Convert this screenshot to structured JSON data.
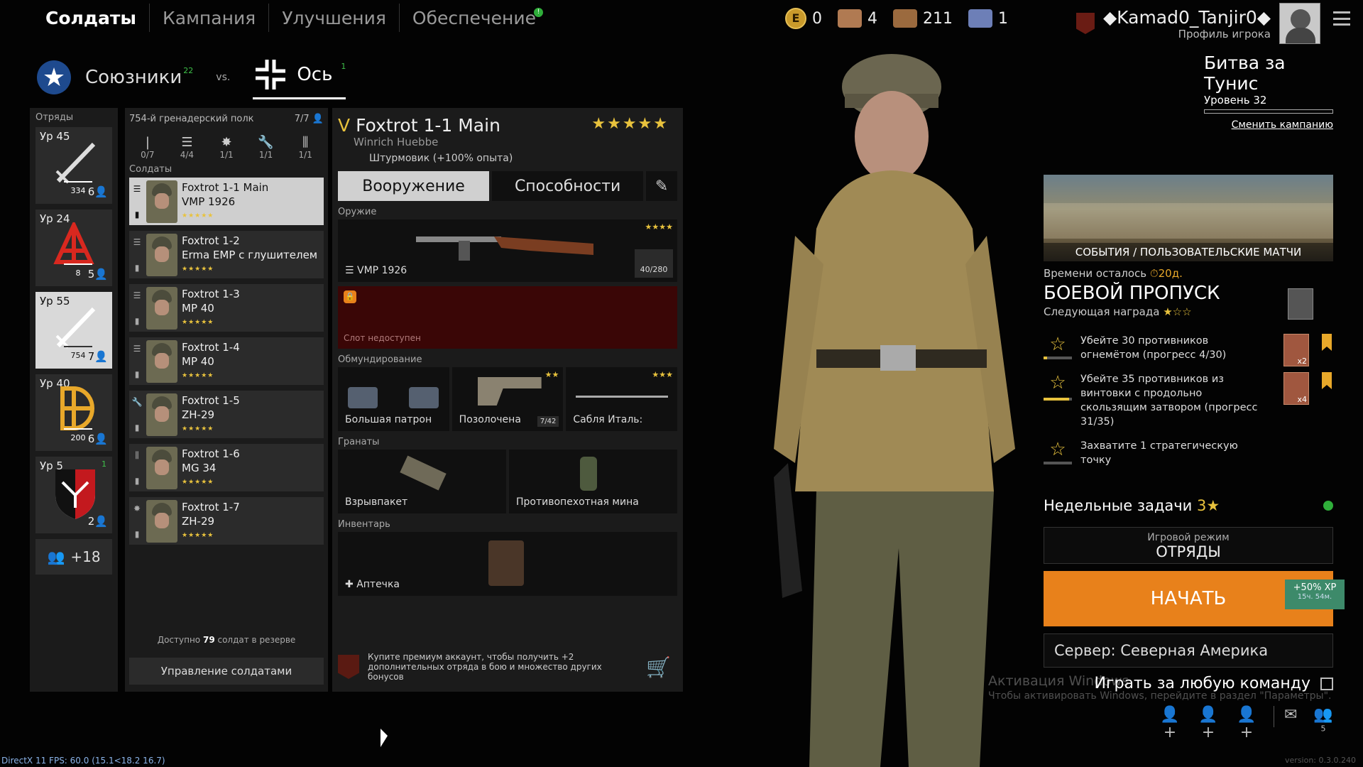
{
  "nav": {
    "tabs": [
      "Солдаты",
      "Кампания",
      "Улучшения",
      "Обеспечение"
    ],
    "supply_badge": "!"
  },
  "currencies": [
    {
      "icon": "gold-coin-icon",
      "value": "0"
    },
    {
      "icon": "weapon-order-icon",
      "value": "4"
    },
    {
      "icon": "soldier-order-icon",
      "value": "211"
    },
    {
      "icon": "silver-order-icon",
      "value": "1"
    }
  ],
  "player": {
    "name": "◆Kamad0_Tanjir0◆",
    "profile_label": "Профиль игрока"
  },
  "factions": {
    "allies": {
      "name": "Союзники",
      "count": "22"
    },
    "vs": "vs.",
    "axis": {
      "name": "Ось",
      "count": "1"
    }
  },
  "squads": {
    "header": "Отряды",
    "items": [
      {
        "level": "Ур 45",
        "xp": "334",
        "count": "6",
        "icon": "sword-icon"
      },
      {
        "level": "Ур 24",
        "xp": "8",
        "count": "5",
        "icon": "tank-emblem-icon"
      },
      {
        "level": "Ур 55",
        "xp": "754",
        "count": "7",
        "icon": "sword-icon"
      },
      {
        "level": "Ур 40",
        "xp": "200",
        "count": "6",
        "icon": "flame-emblem-icon"
      },
      {
        "level": "Ур 5",
        "xp": "",
        "count": "2",
        "icon": "shield-emblem-icon",
        "badge": "1"
      }
    ],
    "more": "+18"
  },
  "soldiers_panel": {
    "regiment": "754-й гренадерский полк",
    "capacity": "7/7",
    "roles": [
      "0/7",
      "4/4",
      "1/1",
      "1/1",
      "1/1"
    ],
    "header": "Солдаты",
    "list": [
      {
        "name": "Foxtrot 1-1 Main",
        "weapon": "VMP 1926"
      },
      {
        "name": "Foxtrot 1-2",
        "weapon": "Erma EMP с глушителем"
      },
      {
        "name": "Foxtrot 1-3",
        "weapon": "MP 40"
      },
      {
        "name": "Foxtrot 1-4",
        "weapon": "MP 40"
      },
      {
        "name": "Foxtrot 1-5",
        "weapon": "ZH-29"
      },
      {
        "name": "Foxtrot 1-6",
        "weapon": "MG 34"
      },
      {
        "name": "Foxtrot 1-7",
        "weapon": "ZH-29"
      }
    ],
    "reserve_prefix": "Доступно ",
    "reserve_count": "79",
    "reserve_suffix": " солдат в резерве",
    "manage": "Управление солдатами"
  },
  "detail": {
    "rank": "V",
    "name": "Foxtrot 1-1 Main",
    "stars": "★★★★★",
    "fullname": "Winrich Huebbe",
    "class": "Штурмовик",
    "class_bonus": "(+100% опыта)",
    "tabs": [
      "Вооружение",
      "Способности"
    ],
    "weapons_label": "Оружие",
    "weapon_name": "VMP 1926",
    "weapon_stars": "★★★★",
    "ammo": "40/280",
    "slot_unavailable": "Слот недоступен",
    "gear_label": "Обмундирование",
    "gear": [
      {
        "name": "Большая патрон",
        "stars": ""
      },
      {
        "name": "Позолочена",
        "stars": "★★",
        "ammo": "7/42"
      },
      {
        "name": "Сабля Италь:",
        "stars": "★★★"
      }
    ],
    "grenades_label": "Гранаты",
    "grenades": [
      "Взрывпакет",
      "Противопехотная мина"
    ],
    "inventory_label": "Инвентарь",
    "inventory": "Аптечка",
    "premium_text": "Купите премиум аккаунт, чтобы получить +2 дополнительных отряда в бою и множество других бонусов"
  },
  "campaign": {
    "title": "Битва за Тунис",
    "level": "Уровень 32",
    "change": "Сменить кампанию"
  },
  "events_label": "СОБЫТИЯ / ПОЛЬЗОВАТЕЛЬСКИЕ МАТЧИ",
  "battlepass": {
    "time_label": "Времени осталось",
    "time_value": "20д.",
    "title": "БОЕВОЙ ПРОПУСК",
    "next_reward": "Следующая награда",
    "tasks": [
      {
        "text": "Убейте 30 противников огнемётом (прогресс 4/30)",
        "reward_mult": "x2",
        "progress": 0.13
      },
      {
        "text": "Убейте 35 противников из винтовки с продольно скользящим затвором (прогресс 31/35)",
        "reward_mult": "x4",
        "progress": 0.89
      },
      {
        "text": "Захватите 1 стратегическую точку",
        "reward_mult": "",
        "progress": 0
      }
    ]
  },
  "weekly": {
    "label": "Недельные задачи",
    "count": "3★"
  },
  "mode": {
    "label": "Игровой режим",
    "value": "ОТРЯДЫ"
  },
  "start": {
    "label": "НАЧАТЬ",
    "bonus": "+50% XP",
    "bonus_time": "15ч. 54м."
  },
  "server": "Сервер: Северная Америка",
  "any_team": "Играть за любую команду",
  "windows": {
    "line1": "Активация Windows",
    "line2": "Чтобы активировать Windows, перейдите в раздел \"Параметры\"."
  },
  "friends_count": "5",
  "fps": "DirectX 11 FPS: 60.0 (15.1<18.2 16.7)",
  "version": "version: 0.3.0.240",
  "colors": {
    "accent": "#e8811b",
    "star": "#e8c23d",
    "panel": "#1b1b1b"
  }
}
